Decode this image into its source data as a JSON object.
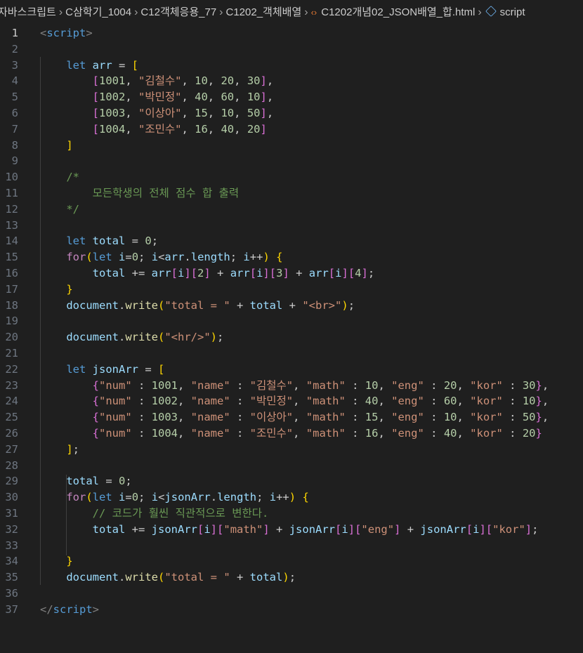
{
  "breadcrumb": {
    "items": [
      "자바스크립트",
      "C삼학기_1004",
      "C12객체응용_77",
      "C1202_객체배열"
    ],
    "file": "C1202개념02_JSON배열_합.html",
    "symbol": "script",
    "file_icon": "html-file-icon",
    "symbol_icon": "cube-icon"
  },
  "editor": {
    "active_line": 1,
    "lines": [
      {
        "n": "1"
      },
      {
        "n": "2"
      },
      {
        "n": "3"
      },
      {
        "n": "4"
      },
      {
        "n": "5"
      },
      {
        "n": "6"
      },
      {
        "n": "7"
      },
      {
        "n": "8"
      },
      {
        "n": "9"
      },
      {
        "n": "10"
      },
      {
        "n": "11"
      },
      {
        "n": "12"
      },
      {
        "n": "13"
      },
      {
        "n": "14"
      },
      {
        "n": "15"
      },
      {
        "n": "16"
      },
      {
        "n": "17"
      },
      {
        "n": "18"
      },
      {
        "n": "19"
      },
      {
        "n": "20"
      },
      {
        "n": "21"
      },
      {
        "n": "22"
      },
      {
        "n": "23"
      },
      {
        "n": "24"
      },
      {
        "n": "25"
      },
      {
        "n": "26"
      },
      {
        "n": "27"
      },
      {
        "n": "28"
      },
      {
        "n": "29"
      },
      {
        "n": "30"
      },
      {
        "n": "31"
      },
      {
        "n": "32"
      },
      {
        "n": "33"
      },
      {
        "n": "34"
      },
      {
        "n": "35"
      },
      {
        "n": "36"
      },
      {
        "n": "37"
      }
    ],
    "code": {
      "l1_open": "<",
      "l1_tag": "script",
      "l1_close": ">",
      "kw_let": "let",
      "kw_for": "for",
      "arr": "arr",
      "rows": [
        {
          "id": "1001",
          "name": "\"김철수\"",
          "a": "10",
          "b": "20",
          "c": "30"
        },
        {
          "id": "1002",
          "name": "\"박민정\"",
          "a": "40",
          "b": "60",
          "c": "10"
        },
        {
          "id": "1003",
          "name": "\"이상아\"",
          "a": "15",
          "b": "10",
          "c": "50"
        },
        {
          "id": "1004",
          "name": "\"조민수\"",
          "a": "16",
          "b": "40",
          "c": "20"
        }
      ],
      "comment_open": "/*",
      "comment_text": "모든학생의 전체 점수 합 출력",
      "comment_close": "*/",
      "str_total": "\"total = \"",
      "str_br": "\"<br>\"",
      "str_hr": "\"<hr/>\"",
      "comment_line": "// 코드가 훨씬 직관적으로 변한다.",
      "key_num": "\"num\"",
      "key_name": "\"name\"",
      "key_math": "\"math\"",
      "key_eng": "\"eng\"",
      "key_kor": "\"kor\""
    }
  },
  "colors": {
    "background": "#1f1f1f",
    "keyword": "#569cd6",
    "control": "#c586c0",
    "variable": "#9cdcfe",
    "function": "#dcdcaa",
    "number": "#b5cea8",
    "string": "#ce9178",
    "comment": "#6a9955"
  }
}
